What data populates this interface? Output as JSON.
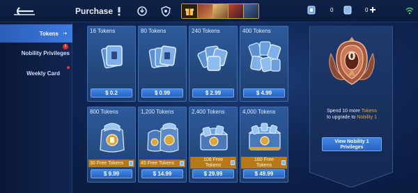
{
  "header": {
    "title": "Purchase",
    "currency_1": "0",
    "currency_2": "0"
  },
  "sidebar": {
    "items": [
      {
        "label": "Tokens"
      },
      {
        "label": "Nobility Privileges"
      },
      {
        "label": "Weekly Card"
      }
    ],
    "badge": "!"
  },
  "packs": [
    {
      "name": "16 Tokens",
      "price": "$ 0.2"
    },
    {
      "name": "80 Tokens",
      "price": "$ 0.99"
    },
    {
      "name": "240 Tokens",
      "price": "$ 2.99"
    },
    {
      "name": "400 Tokens",
      "price": "$ 4.99"
    },
    {
      "name": "800 Tokens",
      "bonus": "30 Free Tokens",
      "price": "$ 9.99"
    },
    {
      "name": "1,200 Tokens",
      "bonus": "45 Free Tokens",
      "price": "$ 14.99"
    },
    {
      "name": "2,400 Tokens",
      "bonus_line1": "108 Free",
      "bonus_line2": "Tokens",
      "price": "$ 29.99"
    },
    {
      "name": "4,000 Tokens",
      "bonus_line1": "180 Free",
      "bonus_line2": "Tokens",
      "price": "$ 49.99"
    }
  ],
  "nobility": {
    "level": "0",
    "line1_a": "Spend 10 more ",
    "line1_b": "Tokens",
    "line2_a": "to upgrade to ",
    "line2_b": "Nobility 1",
    "button_line1": "View Nobility 1",
    "button_line2": "Privileges"
  },
  "colors": {
    "accent_blue": "#3f86e6",
    "bonus_gold": "#b57a16",
    "highlight": "#f0a23c"
  }
}
